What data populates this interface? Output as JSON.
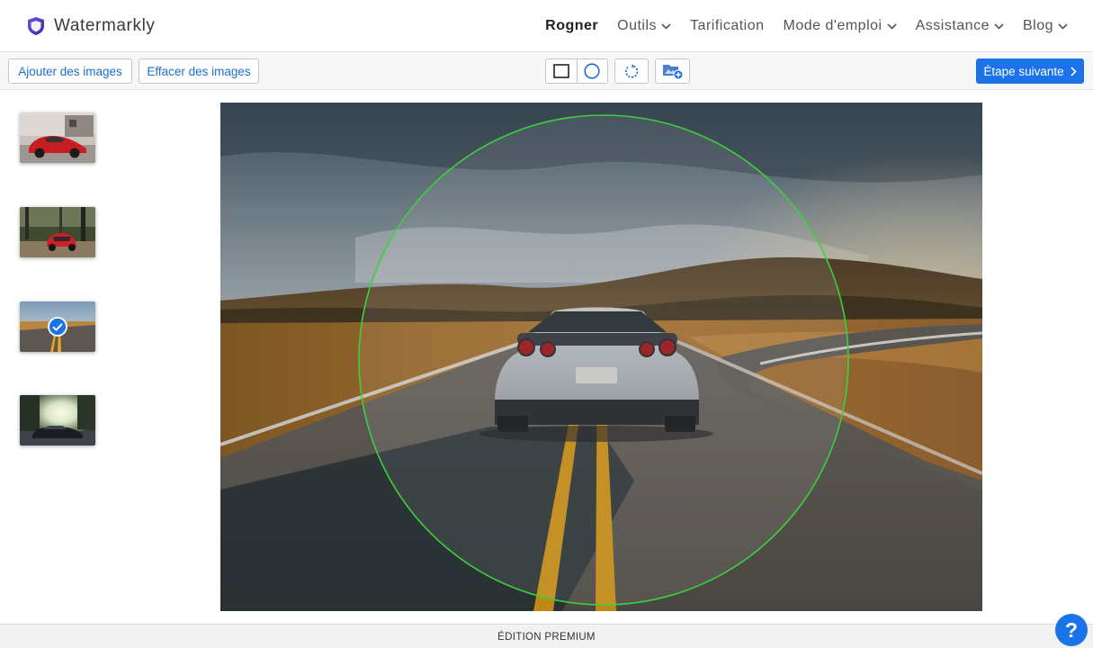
{
  "brand": {
    "name": "Watermarkly"
  },
  "nav": {
    "items": [
      {
        "label": "Rogner",
        "active": true,
        "dropdown": false
      },
      {
        "label": "Outils",
        "active": false,
        "dropdown": true
      },
      {
        "label": "Tarification",
        "active": false,
        "dropdown": false
      },
      {
        "label": "Mode d'emploi",
        "active": false,
        "dropdown": true
      },
      {
        "label": "Assistance",
        "active": false,
        "dropdown": true
      },
      {
        "label": "Blog",
        "active": false,
        "dropdown": true
      }
    ]
  },
  "toolbar": {
    "add_images_label": "Ajouter des images",
    "clear_images_label": "Effacer des images",
    "next_step_label": "Étape suivante",
    "selected_shape": "circle",
    "icons": [
      "square-crop-icon",
      "circle-crop-icon",
      "rotate-icon",
      "add-image-icon"
    ]
  },
  "sidebar": {
    "thumbnails": [
      {
        "subject": "red classic car in front of house",
        "selected": false
      },
      {
        "subject": "red small car in forest",
        "selected": false
      },
      {
        "subject": "car on mountain road",
        "selected": true
      },
      {
        "subject": "dark car under sunlit trees",
        "selected": false
      }
    ]
  },
  "canvas": {
    "crop_shape": "circle",
    "crop_outline_color": "#39d23c"
  },
  "footer": {
    "edition_label": "ÉDITION PREMIUM"
  },
  "help": {
    "label": "?"
  },
  "colors": {
    "accent": "#1a73e8",
    "link": "#1c6fd1",
    "crop_outline": "#39d23c"
  }
}
